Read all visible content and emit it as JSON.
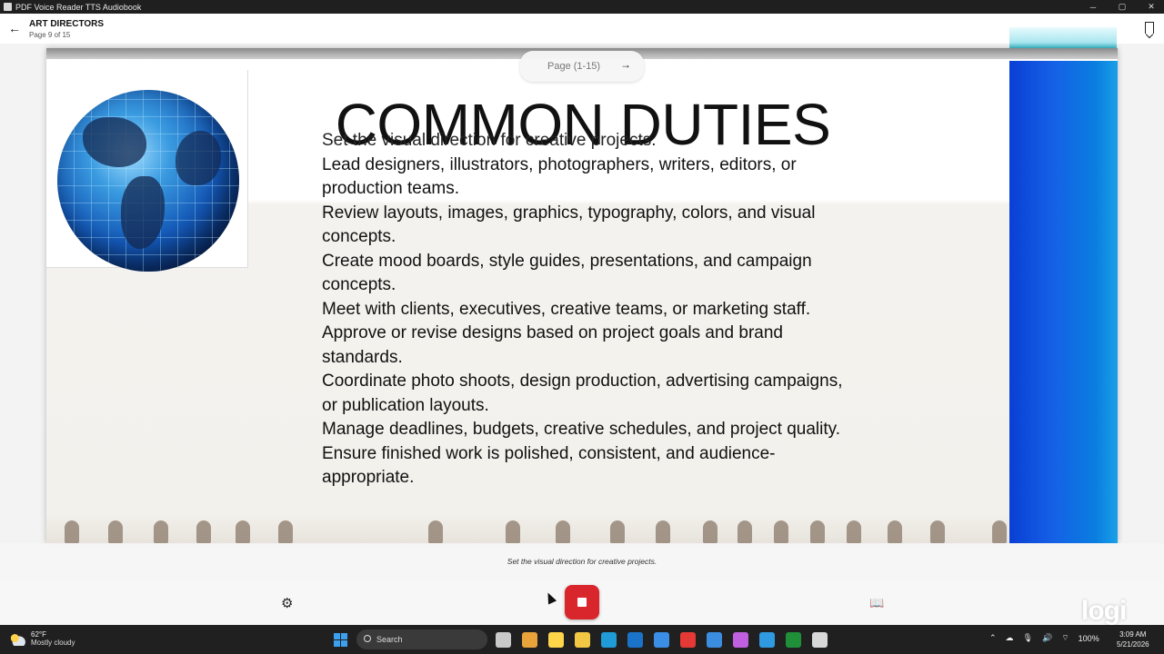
{
  "window": {
    "title": "PDF Voice Reader TTS Audiobook",
    "controls": [
      "─",
      "▢",
      "✕"
    ]
  },
  "header": {
    "title": "ART DIRECTORS",
    "subtitle": "Page 9 of 15"
  },
  "pager": {
    "label": "Page (1-15)",
    "arrow": "→"
  },
  "slide": {
    "heading": "COMMON DUTIES",
    "duties": [
      "Set the visual direction for creative projects.",
      "Lead designers, illustrators, photographers, writers, editors, or production teams.",
      "Review layouts, images, graphics, typography, colors, and visual concepts.",
      "Create mood boards, style guides, presentations, and campaign concepts.",
      "Meet with clients, executives, creative teams, or marketing staff.",
      "Approve or revise designs based on project goals and brand standards.",
      "Coordinate photo shoots, design production, advertising campaigns, or publication layouts.",
      "Manage deadlines, budgets, creative schedules, and project quality.",
      "Ensure finished work is polished, consistent, and audience-appropriate."
    ]
  },
  "caption": "Set the visual direction for creative projects.",
  "controls": {
    "settings_icon": "⚙",
    "book_icon": "📖",
    "watermark": "logi"
  },
  "taskbar": {
    "weather_temp": "62°F",
    "weather_desc": "Mostly cloudy",
    "search_placeholder": "Search",
    "battery": "100%",
    "time": "3:09 AM",
    "date": "5/21/2026",
    "app_colors": [
      "#c9c9c9",
      "#e8a33a",
      "#ffd54a",
      "#f2c744",
      "#1f9bd8",
      "#1a73c8",
      "#3a8ee6",
      "#e53935",
      "#3b8de0",
      "#c060e0",
      "#2f9ae0",
      "#1f8f3a",
      "#d8d8d8"
    ]
  }
}
